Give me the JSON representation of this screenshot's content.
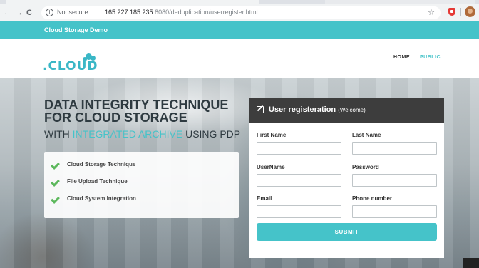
{
  "browser": {
    "nav": {
      "back": "←",
      "forward": "→",
      "reload": "C"
    },
    "security_label": "Not secure",
    "info_glyph": "i",
    "url_host": "165.227.185.235",
    "url_rest": ":8080/deduplication/userregister.html",
    "icons": [
      "back-arrow-icon",
      "forward-arrow-icon",
      "reload-icon",
      "info-icon",
      "star-icon",
      "extension-icon",
      "profile-avatar"
    ]
  },
  "site": {
    "topbar_title": "Cloud Storage Demo",
    "logo_text": ".CLOUD",
    "nav": [
      {
        "label": "HOME"
      },
      {
        "label": "PUBLIC"
      }
    ],
    "accent_color": "#45c3c9"
  },
  "hero": {
    "headline_line1": "DATA INTEGRITY TECHNIQUE",
    "headline_line2": "FOR CLOUD STORAGE",
    "sub_prefix": "WITH ",
    "sub_accent": "INTEGRATED ARCHIVE",
    "sub_suffix": " USING PDP",
    "features": [
      {
        "label": "Cloud Storage Technique"
      },
      {
        "label": "File Upload Technique"
      },
      {
        "label": "Cloud System Integration"
      }
    ]
  },
  "form": {
    "title": "User registeration",
    "subtitle": "(Welcome)",
    "fields": {
      "first_name": {
        "label": "First Name",
        "value": ""
      },
      "last_name": {
        "label": "Last Name",
        "value": ""
      },
      "username": {
        "label": "UserName",
        "value": ""
      },
      "password": {
        "label": "Password",
        "value": ""
      },
      "email": {
        "label": "Email",
        "value": ""
      },
      "phone": {
        "label": "Phone number",
        "value": ""
      }
    },
    "submit_label": "SUBMIT"
  }
}
